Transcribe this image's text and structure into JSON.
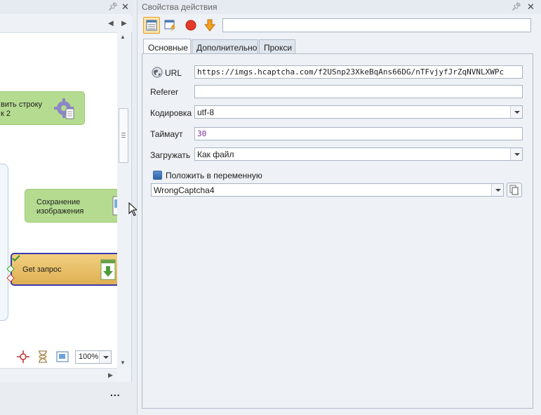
{
  "left_panel": {
    "nodes": {
      "n1": "вить строку\nк 2",
      "n2": "Сохранение\nизображения",
      "n3": "Get запрос"
    },
    "zoom": "100%",
    "more": "..."
  },
  "right_panel": {
    "title": "Свойства действия",
    "search_value": "",
    "tabs": [
      {
        "label": "Основные",
        "active": true
      },
      {
        "label": "Дополнительно",
        "active": false
      },
      {
        "label": "Прокси",
        "active": false
      }
    ],
    "form": {
      "url_label": "URL",
      "url_value": "https://imgs.hcaptcha.com/f2USnp23XkeBqAns66DG/nTFvjyfJrZqNVNLXWPc",
      "referer_label": "Referer",
      "referer_value": "",
      "encoding_label": "Кодировка",
      "encoding_value": "utf-8",
      "timeout_label": "Таймаут",
      "timeout_value": "30",
      "load_label": "Загружать",
      "load_value": "Как файл",
      "put_var_label": "Положить в переменную",
      "variable_value": "WrongCaptcha4"
    }
  },
  "colors": {
    "node_green": "#b5db90",
    "node_orange": "#dfb055",
    "selection_border": "#3a3ab0",
    "timeout_text": "#7a2c9a"
  }
}
